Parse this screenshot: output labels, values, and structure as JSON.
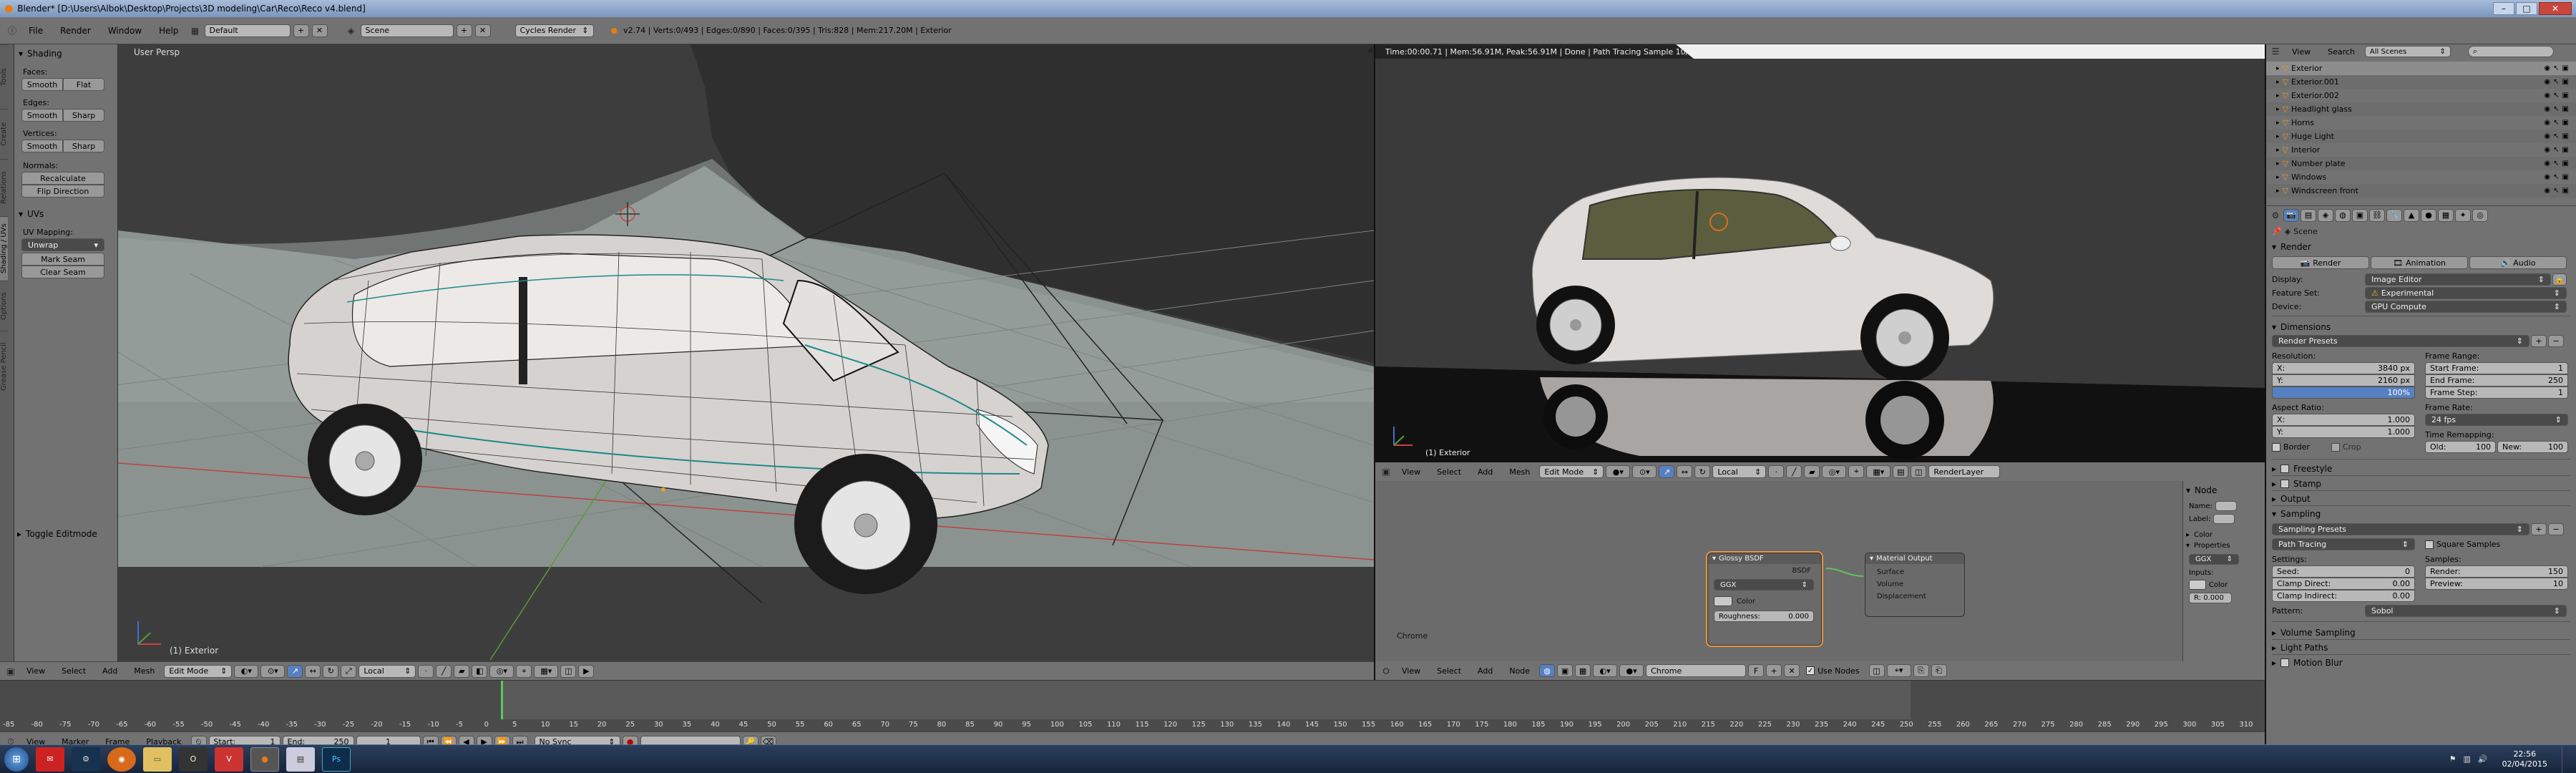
{
  "window": {
    "title": "Blender* [D:\\Users\\Albok\\Desktop\\Projects\\3D modeling\\Car\\Reco\\Reco v4.blend]",
    "controls": [
      "–",
      "□",
      "✕"
    ]
  },
  "info_bar": {
    "menus": [
      "File",
      "Render",
      "Window",
      "Help"
    ],
    "layout": "Default",
    "scene": "Scene",
    "engine": "Cycles Render",
    "stats": "v2.74 | Verts:0/493 | Edges:0/890 | Faces:0/395 | Tris:828 | Mem:217.20M | Exterior"
  },
  "left_tabs": [
    "Tools",
    "Create",
    "Relations",
    "Shading / UVs",
    "Options",
    "Grease Pencil"
  ],
  "tool_shelf": {
    "shading_title": "Shading",
    "faces_label": "Faces:",
    "faces_smooth": "Smooth",
    "faces_flat": "Flat",
    "edges_label": "Edges:",
    "edges_smooth": "Smooth",
    "edges_sharp": "Sharp",
    "verts_label": "Vertices:",
    "verts_smooth": "Smooth",
    "verts_sharp": "Sharp",
    "normals_label": "Normals:",
    "recalculate": "Recalculate",
    "flip_direction": "Flip Direction",
    "uvs_title": "UVs",
    "uv_mapping_label": "UV Mapping:",
    "unwrap": "Unwrap",
    "mark_seam": "Mark Seam",
    "clear_seam": "Clear Seam",
    "toggle_editmode": "Toggle Editmode"
  },
  "viewport_left": {
    "label": "User Persp",
    "object_label": "(1) Exterior",
    "header": {
      "menus": [
        "View",
        "Select",
        "Add",
        "Mesh"
      ],
      "mode": "Edit Mode",
      "orientation": "Local"
    }
  },
  "viewport_right": {
    "render_info": "Time:00:00.71 | Mem:56.91M, Peak:56.91M | Done | Path Tracing Sample 10/10",
    "object_label": "(1) Exterior",
    "header": {
      "menus": [
        "View",
        "Select",
        "Add",
        "Mesh"
      ],
      "mode": "Edit Mode",
      "orientation": "Local",
      "render_layer": "RenderLayer"
    }
  },
  "node_editor": {
    "material_name": "Chrome",
    "glossy": {
      "title": "Glossy BSDF",
      "output": "BSDF",
      "distribution": "GGX",
      "color_label": "Color",
      "roughness": "Roughness:",
      "roughness_value": "0.000"
    },
    "output": {
      "title": "Material Output",
      "surface": "Surface",
      "volume": "Volume",
      "displacement": "Displacement"
    },
    "side": {
      "node_title": "Node",
      "name_label": "Name:",
      "label_label": "Label:",
      "color_title": "Color",
      "properties_title": "Properties",
      "dist": "GGX",
      "inputs_label": "Inputs:",
      "color_label": "Color",
      "r_value": "R: 0.000"
    },
    "header": {
      "menus": [
        "View",
        "Select",
        "Add",
        "Node"
      ],
      "material": "Chrome",
      "f_label": "F",
      "use_nodes": "Use Nodes"
    }
  },
  "timeline": {
    "menus": [
      "View",
      "Marker",
      "Frame",
      "Playback"
    ],
    "start": "Start:",
    "start_value": "1",
    "end": "End:",
    "end_value": "250",
    "current": "1",
    "sync": "No Sync",
    "ticks": [
      "-85",
      "-80",
      "-75",
      "-70",
      "-65",
      "-60",
      "-55",
      "-50",
      "-45",
      "-40",
      "-35",
      "-30",
      "-25",
      "-20",
      "-15",
      "-10",
      "-5",
      "0",
      "5",
      "10",
      "15",
      "20",
      "25",
      "30",
      "35",
      "40",
      "45",
      "50",
      "55",
      "60",
      "65",
      "70",
      "75",
      "80",
      "85",
      "90",
      "95",
      "100",
      "105",
      "110",
      "115",
      "120",
      "125",
      "130",
      "135",
      "140",
      "145",
      "150",
      "155",
      "160",
      "165",
      "170",
      "175",
      "180",
      "185",
      "190",
      "195",
      "200",
      "205",
      "210",
      "215",
      "220",
      "225",
      "230",
      "235",
      "240",
      "245",
      "250",
      "255",
      "260",
      "265",
      "270",
      "275",
      "280",
      "285",
      "290",
      "295",
      "300",
      "305",
      "310"
    ]
  },
  "outliner": {
    "menus": [
      "View",
      "Search"
    ],
    "scenes": "All Scenes",
    "items": [
      "Exterior",
      "Exterior.001",
      "Exterior.002",
      "Headlight glass",
      "Horns",
      "Huge Light",
      "Interior",
      "Number plate",
      "Windows",
      "Windscreen front"
    ]
  },
  "properties": {
    "scene": "Scene",
    "render_title": "Render",
    "render_btn": "Render",
    "animation_btn": "Animation",
    "audio_btn": "Audio",
    "display_label": "Display:",
    "display_value": "Image Editor",
    "feature_label": "Feature Set:",
    "feature_value": "Experimental",
    "device_label": "Device:",
    "device_value": "GPU Compute",
    "dimensions_title": "Dimensions",
    "render_presets": "Render Presets",
    "resolution_label": "Resolution:",
    "res_x": "X:",
    "res_x_value": "3840 px",
    "res_y": "Y:",
    "res_y_value": "2160 px",
    "res_pct": "100%",
    "frame_range_label": "Frame Range:",
    "start_frame": "Start Frame:",
    "start_frame_value": "1",
    "end_frame": "End Frame:",
    "end_frame_value": "250",
    "frame_step": "Frame Step:",
    "frame_step_value": "1",
    "aspect_label": "Aspect Ratio:",
    "asp_x": "X:",
    "asp_x_value": "1.000",
    "asp_y": "Y:",
    "asp_y_value": "1.000",
    "frame_rate_label": "Frame Rate:",
    "fps": "24 fps",
    "border": "Border",
    "crop": "Crop",
    "time_remap_label": "Time Remapping:",
    "old": "Old:",
    "old_value": "100",
    "new": "New:",
    "new_value": "100",
    "freestyle_title": "Freestyle",
    "stamp_title": "Stamp",
    "output_title": "Output",
    "sampling_title": "Sampling",
    "sampling_presets": "Sampling Presets",
    "integrator": "Path Tracing",
    "square_samples": "Square Samples",
    "settings_label": "Settings:",
    "seed": "Seed:",
    "seed_value": "0",
    "clamp_direct": "Clamp Direct:",
    "clamp_direct_value": "0.00",
    "clamp_indirect": "Clamp Indirect:",
    "clamp_indirect_value": "0.00",
    "samples_label": "Samples:",
    "render_samples": "Render:",
    "render_samples_value": "150",
    "preview_samples": "Preview:",
    "preview_samples_value": "10",
    "pattern_label": "Pattern:",
    "pattern_value": "Sobol",
    "volume_sampling_title": "Volume Sampling",
    "light_paths_title": "Light Paths",
    "motion_blur_title": "Motion Blur"
  },
  "taskbar": {
    "time": "22:56",
    "date": "02/04/2015"
  }
}
